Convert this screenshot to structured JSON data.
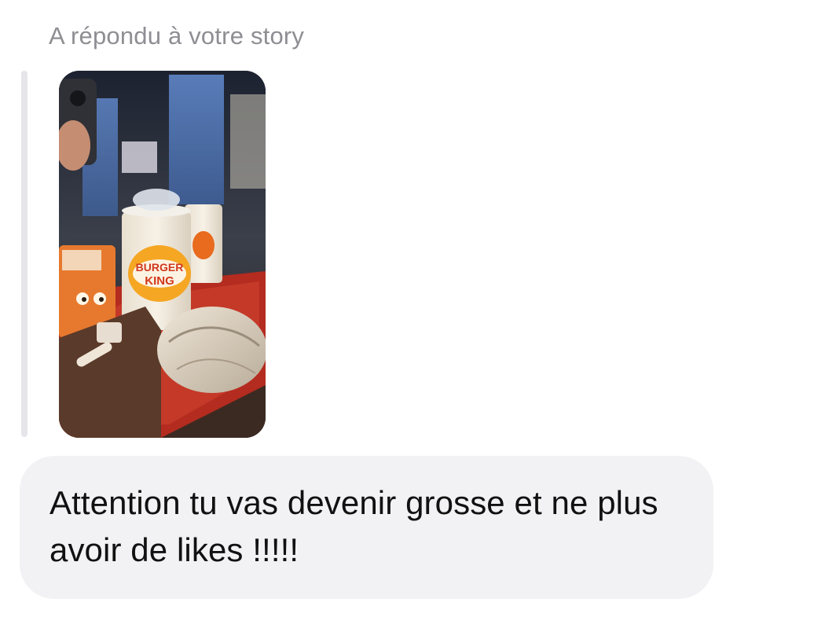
{
  "reply_context": {
    "label": "A répondu à votre story"
  },
  "story_preview": {
    "cup_logo_line1": "BURGER",
    "cup_logo_line2": "KING"
  },
  "message": {
    "text": "Attention tu vas devenir grosse et ne plus avoir de likes !!!!!"
  },
  "colors": {
    "header_text": "#8e8e93",
    "bubble_background": "#f2f2f4",
    "quote_bar": "#e5e5ea",
    "message_text": "#111111"
  }
}
